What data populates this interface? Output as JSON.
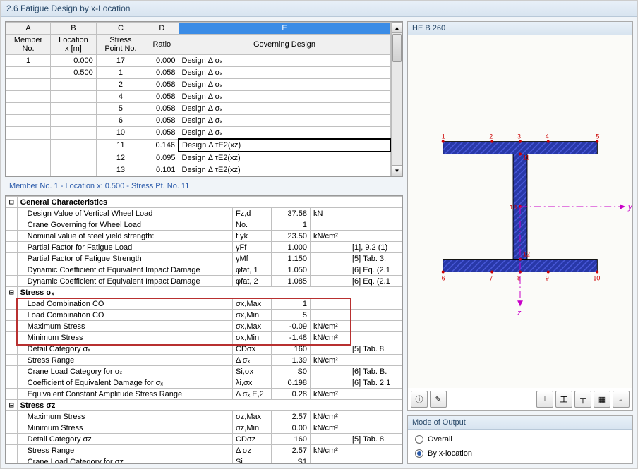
{
  "title": "2.6 Fatigue Design by x-Location",
  "top_grid": {
    "col_letters": [
      "A",
      "B",
      "C",
      "D",
      "E"
    ],
    "headers": [
      "Member\nNo.",
      "Location\nx [m]",
      "Stress\nPoint No.",
      "Ratio",
      "Governing Design"
    ],
    "rows": [
      [
        "1",
        "0.000",
        "17",
        "0.000",
        "Design  Δ σₓ"
      ],
      [
        "",
        "0.500",
        "1",
        "0.058",
        "Design  Δ σₓ"
      ],
      [
        "",
        "",
        "2",
        "0.058",
        "Design  Δ σₓ"
      ],
      [
        "",
        "",
        "4",
        "0.058",
        "Design  Δ σₓ"
      ],
      [
        "",
        "",
        "5",
        "0.058",
        "Design  Δ σₓ"
      ],
      [
        "",
        "",
        "6",
        "0.058",
        "Design  Δ σₓ"
      ],
      [
        "",
        "",
        "10",
        "0.058",
        "Design  Δ σₓ"
      ],
      [
        "",
        "",
        "11",
        "0.146",
        "Design  Δ τE2(xz)"
      ],
      [
        "",
        "",
        "12",
        "0.095",
        "Design  Δ τE2(xz)"
      ],
      [
        "",
        "",
        "13",
        "0.101",
        "Design  Δ τE2(xz)"
      ]
    ],
    "selected_row": 7
  },
  "info_line": "Member No.  1  -  Location x:  0.500  -  Stress Pt. No.  11",
  "details": [
    {
      "type": "group",
      "exp": "⊟",
      "label": "General Characteristics"
    },
    {
      "type": "row",
      "label": "Design Value of Vertical Wheel Load",
      "sym": "Fz,d",
      "val": "37.58",
      "unit": "kN",
      "ref": ""
    },
    {
      "type": "row",
      "label": "Crane Governing for Wheel Load",
      "sym": "No.",
      "val": "1",
      "unit": "",
      "ref": ""
    },
    {
      "type": "row",
      "label": "Nominal value of steel yield strength:",
      "sym": "f yk",
      "val": "23.50",
      "unit": "kN/cm²",
      "ref": ""
    },
    {
      "type": "row",
      "label": "Partial Factor for Fatigue Load",
      "sym": "γFf",
      "val": "1.000",
      "unit": "",
      "ref": "[1], 9.2 (1)"
    },
    {
      "type": "row",
      "label": "Partial Factor of Fatigue Strength",
      "sym": "γMf",
      "val": "1.150",
      "unit": "",
      "ref": "[5] Tab. 3."
    },
    {
      "type": "row",
      "label": "Dynamic Coefficient of Equivalent Impact Damage",
      "sym": "φfat, 1",
      "val": "1.050",
      "unit": "",
      "ref": "[6] Eq. (2.1"
    },
    {
      "type": "row",
      "label": "Dynamic Coefficient of Equivalent Impact Damage",
      "sym": "φfat, 2",
      "val": "1.085",
      "unit": "",
      "ref": "[6] Eq. (2.1"
    },
    {
      "type": "group",
      "exp": "⊟",
      "label": "Stress σₓ"
    },
    {
      "type": "row",
      "hl": true,
      "label": "Load Combination CO",
      "sym": "σx,Max",
      "val": "1",
      "unit": "",
      "ref": ""
    },
    {
      "type": "row",
      "hl": true,
      "label": "Load Combination CO",
      "sym": "σx,Min",
      "val": "5",
      "unit": "",
      "ref": ""
    },
    {
      "type": "row",
      "hl": true,
      "label": "Maximum Stress",
      "sym": "σx,Max",
      "val": "-0.09",
      "unit": "kN/cm²",
      "ref": ""
    },
    {
      "type": "row",
      "hl": true,
      "label": "Minimum Stress",
      "sym": "σx,Min",
      "val": "-1.48",
      "unit": "kN/cm²",
      "ref": ""
    },
    {
      "type": "row",
      "label": "Detail Category σₓ",
      "sym": "CDσx",
      "val": "160",
      "unit": "",
      "ref": "[5] Tab. 8."
    },
    {
      "type": "row",
      "label": "Stress Range",
      "sym": "Δ σₓ",
      "val": "1.39",
      "unit": "kN/cm²",
      "ref": ""
    },
    {
      "type": "row",
      "label": "Crane Load Category for σₓ",
      "sym": "Si,σx",
      "val": "S0",
      "unit": "",
      "ref": "[6] Tab. B."
    },
    {
      "type": "row",
      "label": "Coefficient of Equivalent Damage for σₓ",
      "sym": "λi,σx",
      "val": "0.198",
      "unit": "",
      "ref": "[6] Tab. 2.1"
    },
    {
      "type": "row",
      "label": "Equivalent Constant Amplitude Stress Range",
      "sym": "Δ σₓ E,2",
      "val": "0.28",
      "unit": "kN/cm²",
      "ref": ""
    },
    {
      "type": "group",
      "exp": "⊟",
      "label": "Stress σz"
    },
    {
      "type": "row",
      "label": "Maximum Stress",
      "sym": "σz,Max",
      "val": "2.57",
      "unit": "kN/cm²",
      "ref": ""
    },
    {
      "type": "row",
      "label": "Minimum Stress",
      "sym": "σz,Min",
      "val": "0.00",
      "unit": "kN/cm²",
      "ref": ""
    },
    {
      "type": "row",
      "label": "Detail Category σz",
      "sym": "CDσz",
      "val": "160",
      "unit": "",
      "ref": "[5] Tab. 8."
    },
    {
      "type": "row",
      "label": "Stress Range",
      "sym": "Δ σz",
      "val": "2.57",
      "unit": "kN/cm²",
      "ref": ""
    },
    {
      "type": "row",
      "label": "Crane Load Category for σz",
      "sym": "Si",
      "val": "S1",
      "unit": "",
      "ref": ""
    }
  ],
  "section_label": "HE B 260",
  "toolbar_icons": [
    "info-icon",
    "link-icon",
    "spacer",
    "sect-icon-1",
    "sect-icon-2",
    "sect-icon-3",
    "sect-icon-4",
    "probe-icon"
  ],
  "mode_panel": {
    "title": "Mode of Output",
    "options": [
      {
        "label": "Overall",
        "checked": false
      },
      {
        "label": "By x-location",
        "checked": true
      }
    ]
  },
  "axes": {
    "y": "y",
    "z": "z"
  },
  "node_numbers": [
    "1",
    "2",
    "3",
    "4",
    "5",
    "6",
    "7",
    "8",
    "9",
    "10",
    "11",
    "12",
    "13"
  ]
}
